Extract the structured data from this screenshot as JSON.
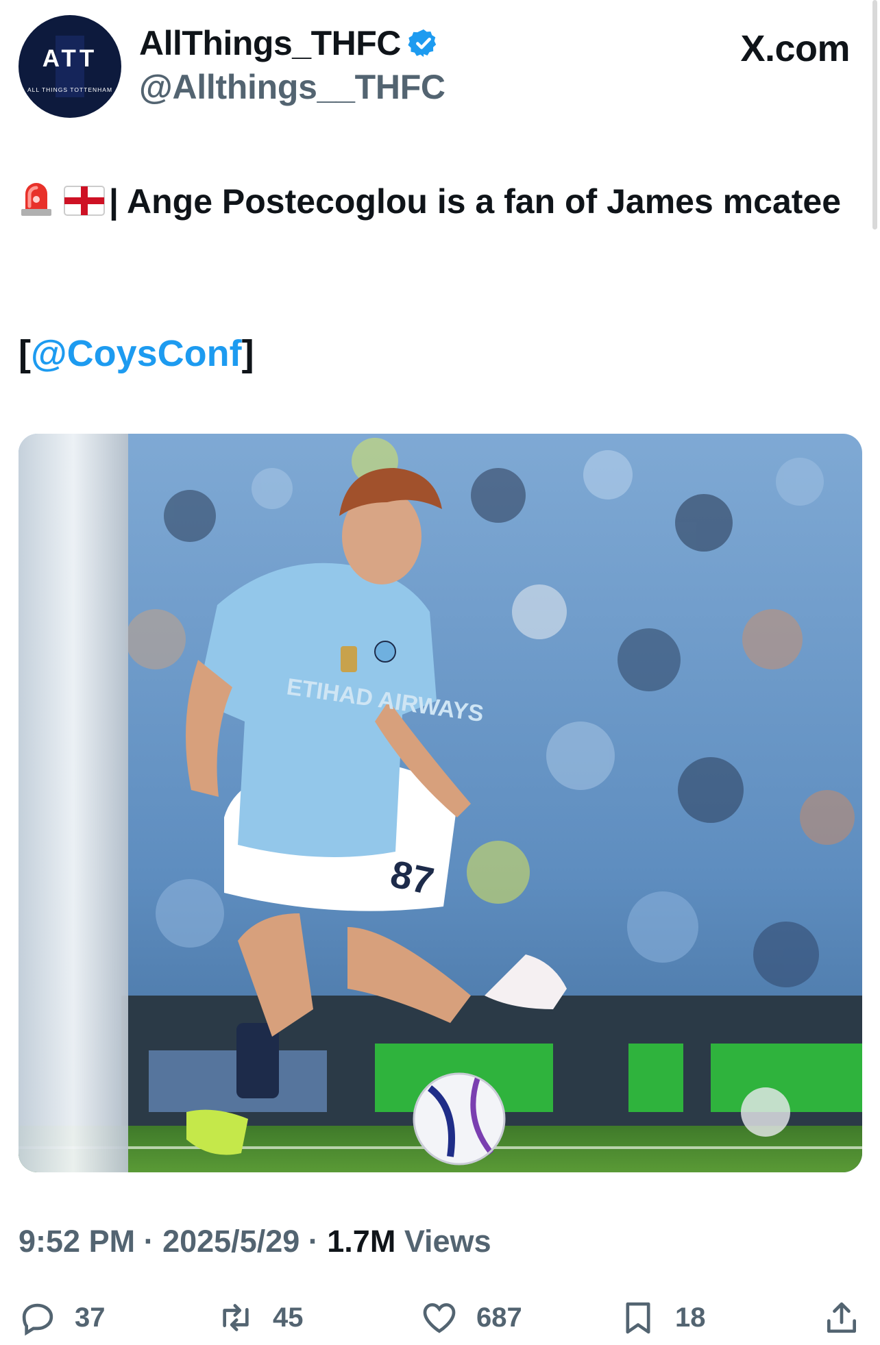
{
  "header": {
    "avatar_monogram": "ATT",
    "avatar_subtitle": "ALL THINGS TOTTENHAM",
    "display_name": "AllThings_THFC",
    "handle": "@Allthings__THFC",
    "brand": "X.com",
    "verified_color": "#1d9bf0"
  },
  "tweet": {
    "text_main": "| Ange Postecoglou is a fan of James mcatee",
    "mention_open": "[",
    "mention": "@CoysConf",
    "mention_close": "]",
    "emojis": [
      "siren-icon",
      "england-flag-icon"
    ]
  },
  "media": {
    "description_icon": "football-photo",
    "kit_text": "ETIHAD AIRWAYS",
    "shirt_number": "87"
  },
  "meta": {
    "time": "9:52 PM",
    "sep1": " · ",
    "date": "2025/5/29",
    "sep2": " · ",
    "views_count": "1.7M",
    "views_label": " Views"
  },
  "actions": {
    "replies": "37",
    "reposts": "45",
    "likes": "687",
    "bookmarks": "18"
  },
  "colors": {
    "link": "#1d9bf0",
    "muted": "#536471",
    "text": "#0f1419"
  }
}
